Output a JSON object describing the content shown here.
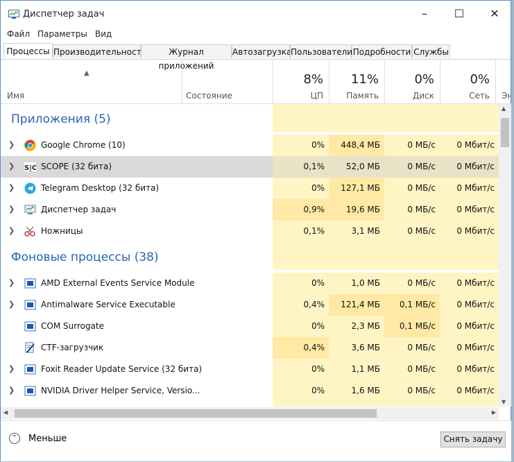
{
  "window": {
    "title": "Диспетчер задач"
  },
  "menu": [
    "Файл",
    "Параметры",
    "Вид"
  ],
  "tabs": [
    "Процессы",
    "Производительность",
    "Журнал приложений",
    "Автозагрузка",
    "Пользователи",
    "Подробности",
    "Службы"
  ],
  "header": {
    "name": "Имя",
    "state": "Состояние",
    "cpu": {
      "pct": "8%",
      "label": "ЦП"
    },
    "mem": {
      "pct": "11%",
      "label": "Память"
    },
    "disk": {
      "pct": "0%",
      "label": "Диск"
    },
    "net": {
      "pct": "0%",
      "label": "Сеть"
    },
    "en": "Эн"
  },
  "groups": {
    "apps": "Приложения (5)",
    "bg": "Фоновые процессы (38)"
  },
  "rows": [
    {
      "name": "Google Chrome (10)",
      "cpu": "0%",
      "mem": "448,4 МБ",
      "disk": "0 МБ/с",
      "net": "0 Мбит/с",
      "icon": "chrome-icon"
    },
    {
      "name": "SCOPE (32 бита)",
      "cpu": "0,1%",
      "mem": "52,0 МБ",
      "disk": "0 МБ/с",
      "net": "0 Мбит/с",
      "icon": "scope-icon"
    },
    {
      "name": "Telegram Desktop (32 бита)",
      "cpu": "0%",
      "mem": "127,1 МБ",
      "disk": "0 МБ/с",
      "net": "0 Мбит/с",
      "icon": "telegram-icon"
    },
    {
      "name": "Диспетчер задач",
      "cpu": "0,9%",
      "mem": "19,6 МБ",
      "disk": "0 МБ/с",
      "net": "0 Мбит/с",
      "icon": "task-manager-icon"
    },
    {
      "name": "Ножницы",
      "cpu": "0,1%",
      "mem": "3,1 МБ",
      "disk": "0 МБ/с",
      "net": "0 Мбит/с",
      "icon": "scissors-icon"
    },
    {
      "name": "AMD External Events Service Module",
      "cpu": "0%",
      "mem": "1,0 МБ",
      "disk": "0 МБ/с",
      "net": "0 Мбит/с",
      "icon": "service-icon"
    },
    {
      "name": "Antimalware Service Executable",
      "cpu": "0,4%",
      "mem": "121,4 МБ",
      "disk": "0,1 МБ/с",
      "net": "0 Мбит/с",
      "icon": "service-icon"
    },
    {
      "name": "COM Surrogate",
      "cpu": "0%",
      "mem": "2,3 МБ",
      "disk": "0,1 МБ/с",
      "net": "0 Мбит/с",
      "icon": "service-icon"
    },
    {
      "name": "CTF-загрузчик",
      "cpu": "0,4%",
      "mem": "3,6 МБ",
      "disk": "0 МБ/с",
      "net": "0 Мбит/с",
      "icon": "ctf-loader-icon"
    },
    {
      "name": "Foxit Reader Update Service (32 бита)",
      "cpu": "0%",
      "mem": "1,1 МБ",
      "disk": "0 МБ/с",
      "net": "0 Мбит/с",
      "icon": "service-icon"
    },
    {
      "name": "NVIDIA Driver Helper Service, Versio...",
      "cpu": "0%",
      "mem": "1,6 МБ",
      "disk": "0 МБ/с",
      "net": "0 Мбит/с",
      "icon": "service-icon"
    }
  ],
  "footer": {
    "less": "Меньше",
    "end_task": "Снять задачу"
  },
  "colors": {
    "heat_light": "#fff4c4",
    "heat_mid": "#ffeaa8",
    "group_title": "#2a63b6",
    "selected_row": "#d9d9d9"
  }
}
